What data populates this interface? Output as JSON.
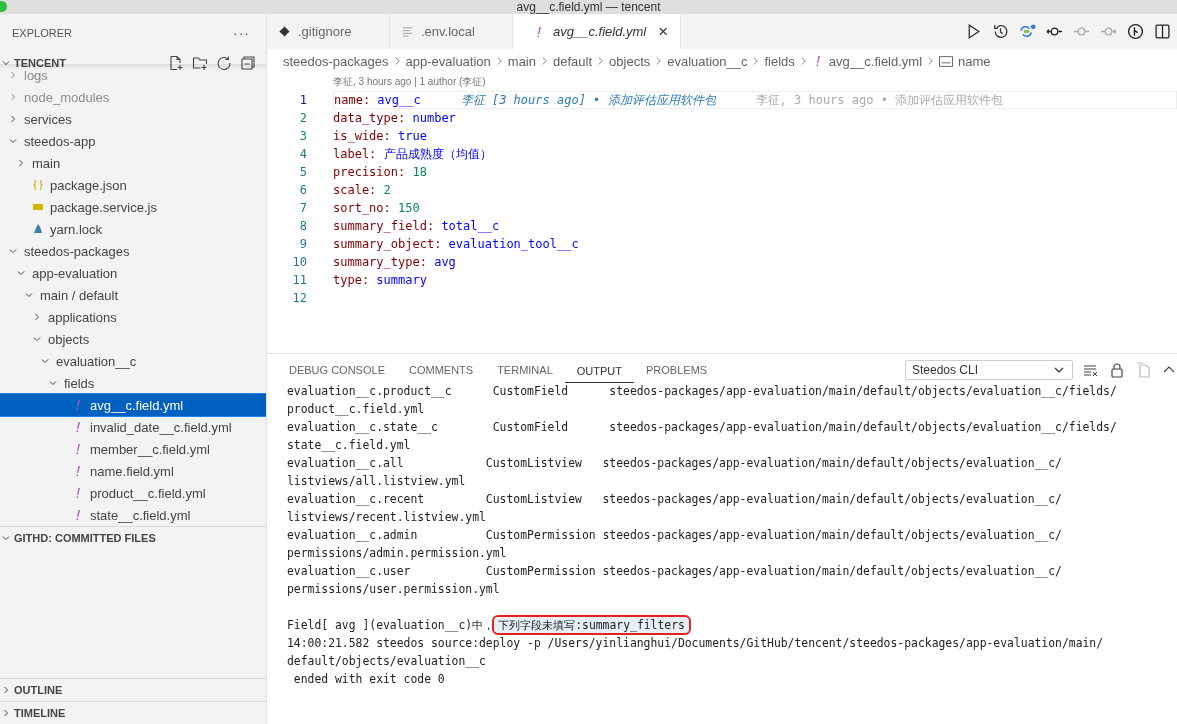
{
  "window": {
    "title": "avg__c.field.yml — tencent"
  },
  "sidebar": {
    "title": "EXPLORER",
    "more": "···",
    "section": {
      "title": "TENCENT",
      "expanded": true
    },
    "tree": [
      {
        "label": "logs",
        "kind": "folder",
        "expanded": false,
        "ignored": true,
        "selected": false
      },
      {
        "label": "node_modules",
        "kind": "folder",
        "expanded": false,
        "ignored": true,
        "selected": false
      },
      {
        "label": "services",
        "kind": "folder",
        "expanded": false,
        "ignored": false,
        "selected": false
      },
      {
        "label": "steedos-app",
        "kind": "folder",
        "expanded": true,
        "ignored": false,
        "selected": false,
        "children": [
          {
            "label": "main",
            "kind": "folder",
            "expanded": false,
            "ignored": false,
            "selected": false
          },
          {
            "label": "package.json",
            "kind": "json",
            "ignored": false,
            "selected": false
          },
          {
            "label": "package.service.js",
            "kind": "js",
            "ignored": false,
            "selected": false
          },
          {
            "label": "yarn.lock",
            "kind": "yarn",
            "ignored": false,
            "selected": false
          }
        ]
      },
      {
        "label": "steedos-packages",
        "kind": "folder",
        "expanded": true,
        "ignored": false,
        "selected": false,
        "children": [
          {
            "label": "app-evaluation",
            "kind": "folder",
            "expanded": true,
            "ignored": false,
            "selected": false,
            "children": [
              {
                "label": "main / default",
                "kind": "folder",
                "expanded": true,
                "ignored": false,
                "selected": false,
                "children": [
                  {
                    "label": "applications",
                    "kind": "folder",
                    "expanded": false,
                    "ignored": false,
                    "selected": false
                  },
                  {
                    "label": "objects",
                    "kind": "folder",
                    "expanded": true,
                    "ignored": false,
                    "selected": false,
                    "children": [
                      {
                        "label": "evaluation__c",
                        "kind": "folder",
                        "expanded": true,
                        "ignored": false,
                        "selected": false,
                        "children": [
                          {
                            "label": "fields",
                            "kind": "folder",
                            "expanded": true,
                            "ignored": false,
                            "selected": false,
                            "children": [
                              {
                                "label": "avg__c.field.yml",
                                "kind": "yaml",
                                "ignored": false,
                                "selected": true
                              },
                              {
                                "label": "invalid_date__c.field.yml",
                                "kind": "yaml",
                                "ignored": false,
                                "selected": false
                              },
                              {
                                "label": "member__c.field.yml",
                                "kind": "yaml",
                                "ignored": false,
                                "selected": false
                              },
                              {
                                "label": "name.field.yml",
                                "kind": "yaml",
                                "ignored": false,
                                "selected": false
                              },
                              {
                                "label": "product__c.field.yml",
                                "kind": "yaml",
                                "ignored": false,
                                "selected": false
                              },
                              {
                                "label": "state__c.field.yml",
                                "kind": "yaml",
                                "ignored": false,
                                "selected": false
                              }
                            ]
                          }
                        ]
                      }
                    ]
                  }
                ]
              }
            ]
          }
        ]
      }
    ],
    "panels": [
      {
        "title": "GITHD: COMMITTED FILES",
        "expanded": true
      },
      {
        "title": "OUTLINE",
        "expanded": false
      },
      {
        "title": "TIMELINE",
        "expanded": false
      }
    ]
  },
  "tabs": [
    {
      "label": ".gitignore",
      "kind": "git",
      "selected": false
    },
    {
      "label": ".env.local",
      "kind": "text",
      "selected": false
    },
    {
      "label": "avg__c.field.yml",
      "kind": "yaml",
      "selected": true,
      "close": "×"
    }
  ],
  "breadcrumb": [
    {
      "label": "steedos-packages",
      "kind": "text"
    },
    {
      "label": "app-evaluation",
      "kind": "text"
    },
    {
      "label": "main",
      "kind": "text"
    },
    {
      "label": "default",
      "kind": "text"
    },
    {
      "label": "objects",
      "kind": "text"
    },
    {
      "label": "evaluation__c",
      "kind": "text"
    },
    {
      "label": "fields",
      "kind": "text"
    },
    {
      "label": "avg__c.field.yml",
      "kind": "yaml"
    },
    {
      "label": "name",
      "kind": "symbol"
    }
  ],
  "blame_header": "李征, 3 hours ago | 1 author (李征)",
  "code": [
    {
      "number": "1",
      "key": "name:",
      "value": "avg__c",
      "kind": "string",
      "blame": "李征 [3 hours ago] • 添加评估应用软件包",
      "ghost": "李征, 3 hours ago • 添加评估应用软件包"
    },
    {
      "number": "2",
      "key": "data_type:",
      "value": "number",
      "kind": "string"
    },
    {
      "number": "3",
      "key": "is_wide:",
      "value": "true",
      "kind": "bool"
    },
    {
      "number": "4",
      "key": "label:",
      "value": "产品成熟度（均值）",
      "kind": "string"
    },
    {
      "number": "5",
      "key": "precision:",
      "value": "18",
      "kind": "number"
    },
    {
      "number": "6",
      "key": "scale:",
      "value": "2",
      "kind": "number"
    },
    {
      "number": "7",
      "key": "sort_no:",
      "value": "150",
      "kind": "number"
    },
    {
      "number": "8",
      "key": "summary_field:",
      "value": "total__c",
      "kind": "string"
    },
    {
      "number": "9",
      "key": "summary_object:",
      "value": "evaluation_tool__c",
      "kind": "string"
    },
    {
      "number": "10",
      "key": "summary_type:",
      "value": "avg",
      "kind": "string"
    },
    {
      "number": "11",
      "key": "type:",
      "value": "summary",
      "kind": "string"
    },
    {
      "number": "12"
    }
  ],
  "panel": {
    "tabs": [
      {
        "label": "DEBUG CONSOLE",
        "selected": false
      },
      {
        "label": "COMMENTS",
        "selected": false
      },
      {
        "label": "TERMINAL",
        "selected": false
      },
      {
        "label": "OUTPUT",
        "selected": true
      },
      {
        "label": "PROBLEMS",
        "selected": false
      }
    ],
    "channel": "Steedos CLI",
    "output": [
      {
        "text": "evaluation__c.product__c      CustomField      steedos-packages/app-evaluation/main/default/objects/evaluation__c/fields/"
      },
      {
        "text": "product__c.field.yml"
      },
      {
        "text": "evaluation__c.state__c        CustomField      steedos-packages/app-evaluation/main/default/objects/evaluation__c/fields/"
      },
      {
        "text": "state__c.field.yml"
      },
      {
        "text": "evaluation__c.all            CustomListview   steedos-packages/app-evaluation/main/default/objects/evaluation__c/"
      },
      {
        "text": "listviews/all.listview.yml"
      },
      {
        "text": "evaluation__c.recent         CustomListview   steedos-packages/app-evaluation/main/default/objects/evaluation__c/"
      },
      {
        "text": "listviews/recent.listview.yml"
      },
      {
        "text": "evaluation__c.admin          CustomPermission steedos-packages/app-evaluation/main/default/objects/evaluation__c/"
      },
      {
        "text": "permissions/admin.permission.yml"
      },
      {
        "text": "evaluation__c.user           CustomPermission steedos-packages/app-evaluation/main/default/objects/evaluation__c/"
      },
      {
        "text": "permissions/user.permission.yml"
      },
      {
        "text": "Field[ avg ](evaluation__c)中，",
        "marked": "下列字段未填写:summary_filters"
      },
      {
        "text": "14:00:21.582 steedos source:deploy -p /Users/yinlianghui/Documents/GitHub/tencent/steedos-packages/app-evaluation/main/"
      },
      {
        "text": "default/objects/evaluation__c"
      },
      {
        "text": " ended with exit code 0"
      }
    ]
  }
}
